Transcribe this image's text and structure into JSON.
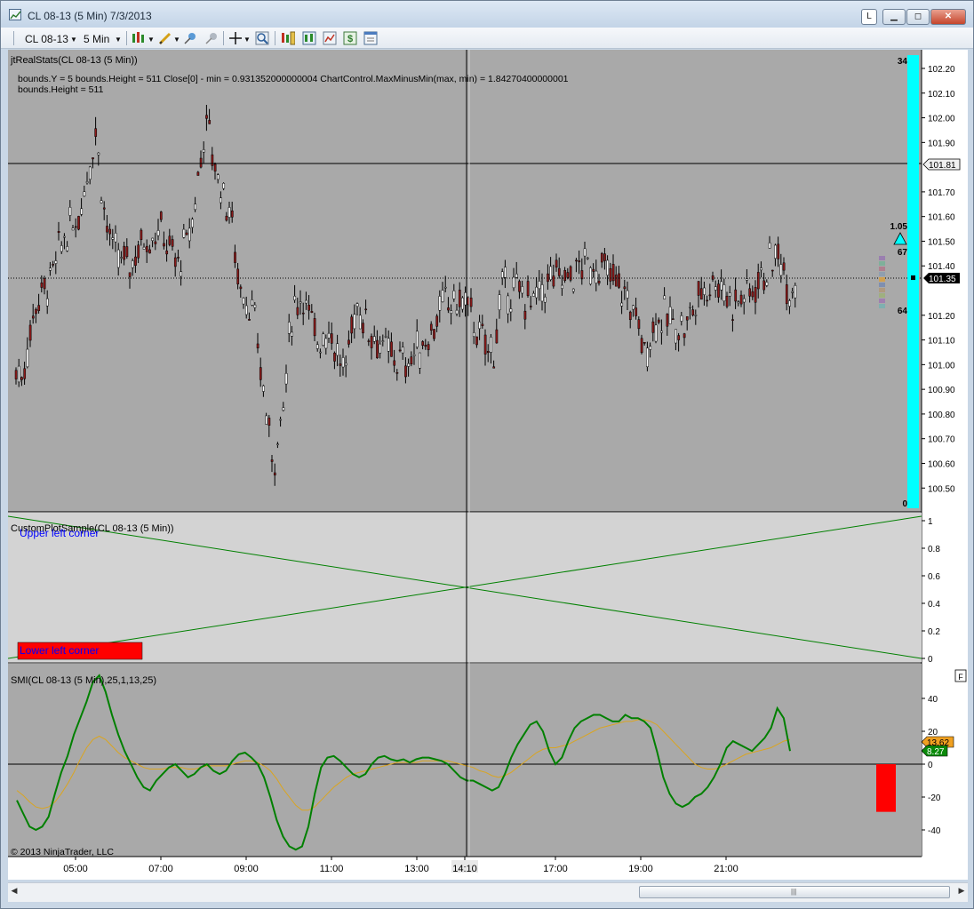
{
  "window": {
    "title": "CL 08-13 (5 Min)  7/3/2013",
    "l_button": "L",
    "min_button": "▭",
    "max_button": "◻",
    "close_button": "✕"
  },
  "toolbar": {
    "instrument": "CL 08-13",
    "interval": "5 Min",
    "icons": [
      "bar-style-icon",
      "pencil-icon",
      "pin-icon",
      "unpin-icon",
      "crosshair-icon",
      "zoom-icon",
      "data-box-icon",
      "indicators-icon",
      "strategy-icon",
      "dollar-icon",
      "properties-icon"
    ]
  },
  "panel_price": {
    "label": "jtRealStats(CL 08-13 (5 Min))",
    "info_line1": "bounds.Y = 5 bounds.Height = 511 Close[0] - min = 0.931352000000004 ChartControl.MaxMinusMin(max, min) = 1.84270400000001",
    "info_line2": "bounds.Height = 511",
    "price_axis": [
      "102.20",
      "102.10",
      "102.00",
      "101.90",
      "101.81",
      "101.70",
      "101.60",
      "101.50",
      "101.40",
      "101.35",
      "101.20",
      "101.10",
      "101.00",
      "100.90",
      "100.80",
      "100.70",
      "100.60",
      "100.50"
    ],
    "marker_price": "101.81",
    "last_price": "101.35",
    "cyan_bar_top": "34",
    "cyan_bar_bottom": "0",
    "sl_value": "1.05",
    "upper_count": "67",
    "lower_count": "64",
    "colors": {
      "background": "#a9a9a9",
      "up": "#ffffff",
      "down": "#8b1a1a",
      "cyan": "#00ffff"
    }
  },
  "panel_custom": {
    "label": "CustomPlotSample(CL 08-13 (5 Min))",
    "upper_left_text": "Upper left corner",
    "lower_left_text": "Lower left corner",
    "axis": [
      "1",
      "0.8",
      "0.6",
      "0.4",
      "0.2",
      "0"
    ],
    "colors": {
      "background": "#d3d3d3",
      "line": "#008000",
      "box": "#ff0000",
      "upper_text": "#0000ff"
    }
  },
  "panel_smi": {
    "label": "SMI(CL 08-13 (5 Min),25,1,13,25)",
    "f_button": "F",
    "axis": [
      "40",
      "20",
      "0",
      "-20",
      "-40"
    ],
    "badge_orange": "13.62",
    "badge_green": "8.27",
    "colors": {
      "smi": "#008000",
      "signal": "#daa520",
      "bar": "#ff0000"
    }
  },
  "copyright": "© 2013 NinjaTrader, LLC",
  "time_axis": [
    "05:00",
    "07:00",
    "09:00",
    "11:00",
    "13:00",
    "14:10",
    "17:00",
    "19:00",
    "21:00"
  ],
  "smi_data": {
    "smi": [
      -22,
      -30,
      -38,
      -40,
      -38,
      -32,
      -18,
      -5,
      5,
      18,
      28,
      38,
      50,
      54,
      44,
      30,
      18,
      8,
      0,
      -8,
      -14,
      -16,
      -10,
      -6,
      -2,
      0,
      -4,
      -8,
      -6,
      -2,
      0,
      -4,
      -6,
      -4,
      2,
      6,
      7,
      4,
      0,
      -8,
      -20,
      -34,
      -44,
      -50,
      -52,
      -50,
      -38,
      -18,
      -2,
      4,
      5,
      2,
      -2,
      -6,
      -8,
      -6,
      0,
      4,
      5,
      3,
      2,
      3,
      1,
      3,
      4,
      4,
      3,
      2,
      0,
      -4,
      -8,
      -10,
      -10,
      -12,
      -14,
      -16,
      -14,
      -6,
      4,
      12,
      18,
      24,
      26,
      20,
      8,
      0,
      4,
      14,
      22,
      26,
      28,
      30,
      30,
      28,
      26,
      26,
      30,
      28,
      28,
      26,
      22,
      8,
      -8,
      -18,
      -24,
      -26,
      -24,
      -20,
      -18,
      -14,
      -8,
      0,
      10,
      14,
      12,
      10,
      8,
      12,
      16,
      22,
      34,
      28,
      8
    ],
    "signal": [
      -16,
      -19,
      -23,
      -26,
      -27,
      -26,
      -23,
      -18,
      -12,
      -5,
      3,
      10,
      15,
      17,
      15,
      11,
      7,
      4,
      2,
      0,
      -2,
      -3,
      -3,
      -3,
      -2,
      -2,
      -2,
      -3,
      -3,
      -2,
      -1,
      -1,
      -1,
      -1,
      0,
      1,
      2,
      2,
      1,
      -1,
      -4,
      -9,
      -15,
      -20,
      -25,
      -28,
      -28,
      -26,
      -22,
      -18,
      -14,
      -11,
      -8,
      -6,
      -5,
      -4,
      -3,
      -2,
      -1,
      0,
      1,
      1,
      1,
      1,
      2,
      2,
      2,
      2,
      2,
      1,
      0,
      -1,
      -2,
      -4,
      -5,
      -7,
      -8,
      -7,
      -5,
      -2,
      1,
      4,
      7,
      9,
      10,
      10,
      11,
      12,
      14,
      16,
      18,
      20,
      22,
      23,
      24,
      25,
      26,
      26,
      27,
      27,
      26,
      24,
      20,
      16,
      12,
      8,
      4,
      0,
      -2,
      -3,
      -3,
      -2,
      0,
      2,
      4,
      6,
      7,
      8,
      9,
      10,
      12,
      14,
      15
    ],
    "bar_value": -29
  }
}
